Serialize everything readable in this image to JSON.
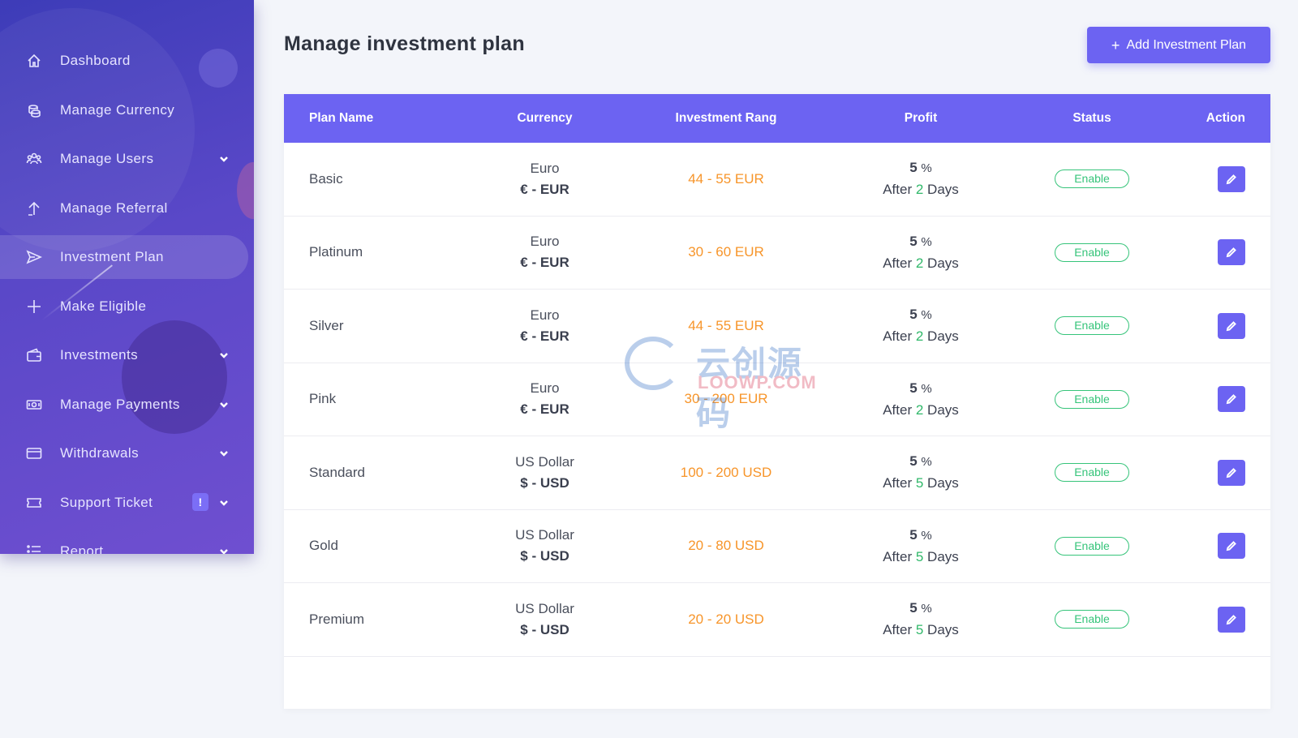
{
  "sidebar": {
    "items": [
      {
        "label": "Dashboard",
        "icon": "home-icon",
        "has_chevron": false
      },
      {
        "label": "Manage Currency",
        "icon": "coins-icon",
        "has_chevron": false
      },
      {
        "label": "Manage Users",
        "icon": "users-icon",
        "has_chevron": true
      },
      {
        "label": "Manage Referral",
        "icon": "arrow-up-icon",
        "has_chevron": false
      },
      {
        "label": "Investment Plan",
        "icon": "send-icon",
        "has_chevron": false,
        "active": true
      },
      {
        "label": "Make Eligible",
        "icon": "plus-icon",
        "has_chevron": false
      },
      {
        "label": "Investments",
        "icon": "wallet-icon",
        "has_chevron": true
      },
      {
        "label": "Manage Payments",
        "icon": "money-icon",
        "has_chevron": true
      },
      {
        "label": "Withdrawals",
        "icon": "card-icon",
        "has_chevron": true
      },
      {
        "label": "Support Ticket",
        "icon": "ticket-icon",
        "has_chevron": true,
        "badge": "!"
      },
      {
        "label": "Report",
        "icon": "list-icon",
        "has_chevron": true
      }
    ]
  },
  "header": {
    "title": "Manage investment plan",
    "add_button": {
      "plus": "+",
      "label": "Add Investment Plan"
    }
  },
  "table": {
    "columns": [
      "Plan Name",
      "Currency",
      "Investment Rang",
      "Profit",
      "Status",
      "Action"
    ],
    "rows": [
      {
        "name": "Basic",
        "currency": "Euro",
        "currency_code": "€ - EUR",
        "range": "44 - 55 EUR",
        "profit": "5",
        "pct": "%",
        "after": "After",
        "days": "2",
        "days_label": "Days",
        "status": "Enable"
      },
      {
        "name": "Platinum",
        "currency": "Euro",
        "currency_code": "€ - EUR",
        "range": "30 - 60 EUR",
        "profit": "5",
        "pct": "%",
        "after": "After",
        "days": "2",
        "days_label": "Days",
        "status": "Enable"
      },
      {
        "name": "Silver",
        "currency": "Euro",
        "currency_code": "€ - EUR",
        "range": "44 - 55 EUR",
        "profit": "5",
        "pct": "%",
        "after": "After",
        "days": "2",
        "days_label": "Days",
        "status": "Enable"
      },
      {
        "name": "Pink",
        "currency": "Euro",
        "currency_code": "€ - EUR",
        "range": "30 - 200 EUR",
        "profit": "5",
        "pct": "%",
        "after": "After",
        "days": "2",
        "days_label": "Days",
        "status": "Enable"
      },
      {
        "name": "Standard",
        "currency": "US Dollar",
        "currency_code": "$ - USD",
        "range": "100 - 200 USD",
        "profit": "5",
        "pct": "%",
        "after": "After",
        "days": "5",
        "days_label": "Days",
        "status": "Enable"
      },
      {
        "name": "Gold",
        "currency": "US Dollar",
        "currency_code": "$ - USD",
        "range": "20 - 80 USD",
        "profit": "5",
        "pct": "%",
        "after": "After",
        "days": "5",
        "days_label": "Days",
        "status": "Enable"
      },
      {
        "name": "Premium",
        "currency": "US Dollar",
        "currency_code": "$ - USD",
        "range": "20 - 20 USD",
        "profit": "5",
        "pct": "%",
        "after": "After",
        "days": "5",
        "days_label": "Days",
        "status": "Enable"
      }
    ]
  },
  "watermark": {
    "cn": "云创源码",
    "en": "LOOWP.COM"
  },
  "colors": {
    "accent": "#6c63f2",
    "range": "#f7952a",
    "days": "#30b86a",
    "status": "#36c47a"
  }
}
